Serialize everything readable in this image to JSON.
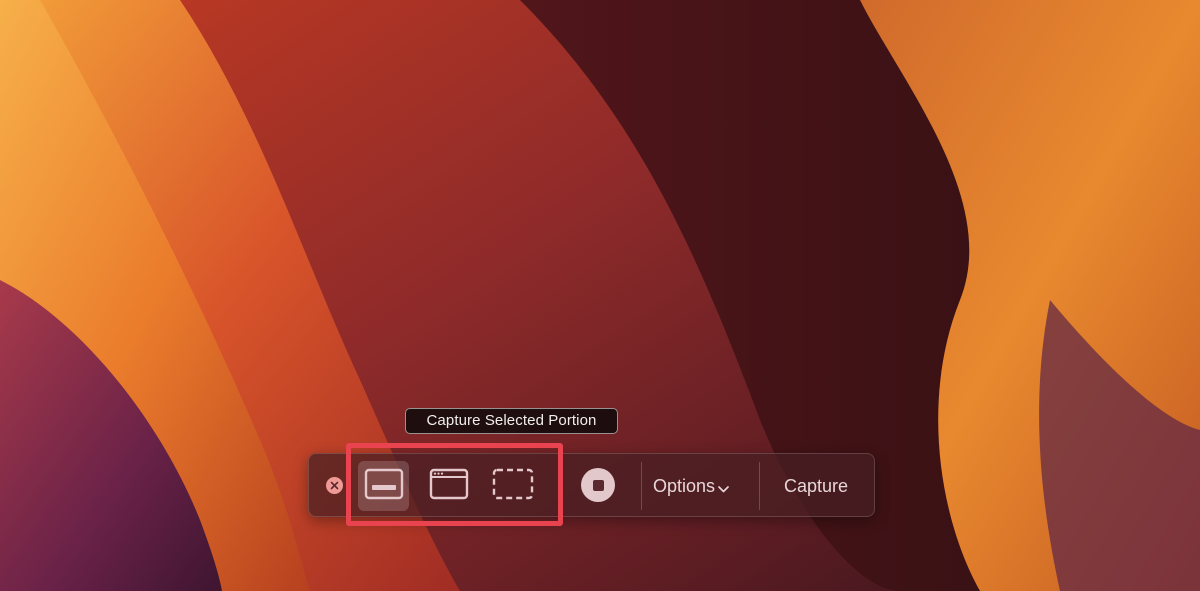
{
  "tooltip": {
    "text": "Capture Selected Portion"
  },
  "toolbar": {
    "close_icon": "close-circle-icon",
    "capture_modes": [
      {
        "icon": "capture-entire-screen-icon",
        "selected": true
      },
      {
        "icon": "capture-window-icon",
        "selected": false
      },
      {
        "icon": "capture-selection-icon",
        "selected": false
      }
    ],
    "record_icon": "record-stop-icon",
    "options_label": "Options",
    "capture_label": "Capture"
  },
  "annotation": {
    "highlight_color": "#e8434e"
  }
}
